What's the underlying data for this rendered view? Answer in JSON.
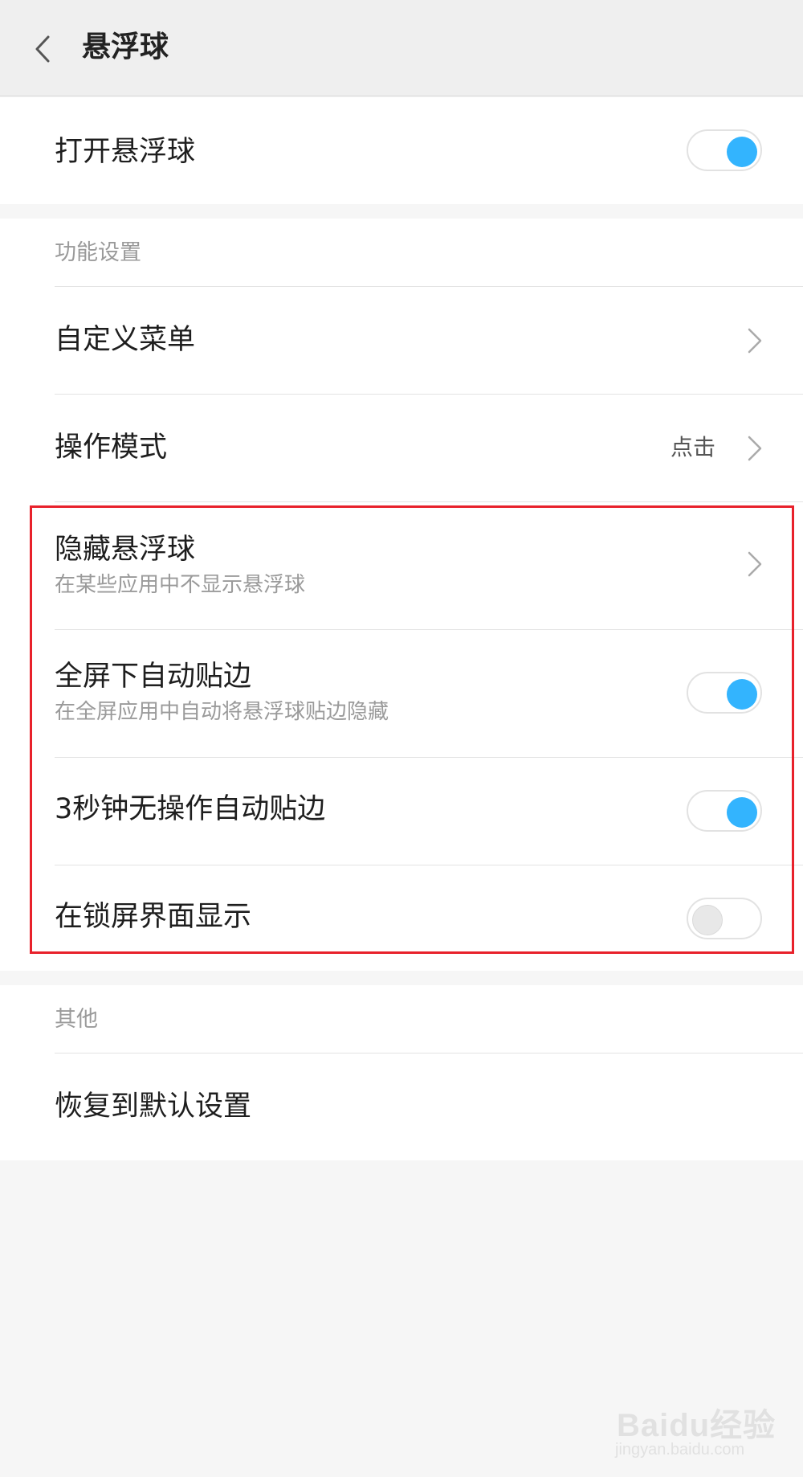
{
  "header": {
    "title": "悬浮球",
    "back_icon": "chevron-left-icon"
  },
  "main_toggle": {
    "label": "打开悬浮球",
    "state": "on"
  },
  "function_section": {
    "header": "功能设置",
    "items": [
      {
        "label": "自定义菜单",
        "type": "link"
      },
      {
        "label": "操作模式",
        "value": "点击",
        "type": "link"
      },
      {
        "label": "隐藏悬浮球",
        "subtitle": "在某些应用中不显示悬浮球",
        "type": "link"
      },
      {
        "label": "全屏下自动贴边",
        "subtitle": "在全屏应用中自动将悬浮球贴边隐藏",
        "type": "toggle",
        "state": "on"
      },
      {
        "label": "3秒钟无操作自动贴边",
        "type": "toggle",
        "state": "on"
      },
      {
        "label": "在锁屏界面显示",
        "type": "toggle",
        "state": "off"
      }
    ]
  },
  "other_section": {
    "header": "其他",
    "items": [
      {
        "label": "恢复到默认设置",
        "type": "action"
      }
    ]
  },
  "watermark": {
    "logo": "Baidu经验",
    "url": "jingyan.baidu.com"
  },
  "colors": {
    "toggle_on": "#33b4fe",
    "highlight": "#e8212b"
  }
}
